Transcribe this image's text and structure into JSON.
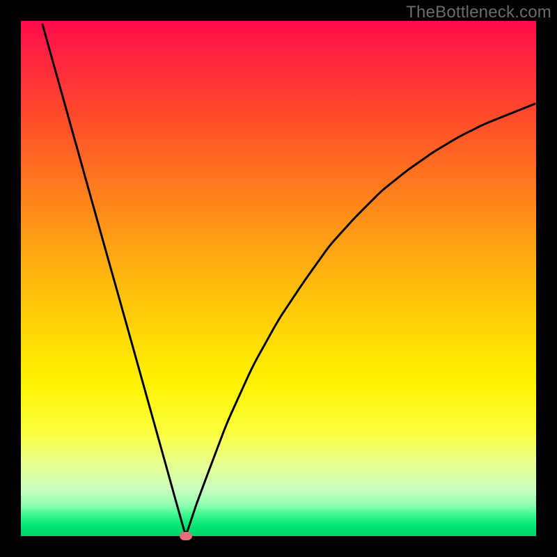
{
  "watermark": "TheBottleneck.com",
  "chart_data": {
    "type": "line",
    "title": "",
    "xlabel": "",
    "ylabel": "",
    "xlim": [
      0,
      100
    ],
    "ylim": [
      0,
      100
    ],
    "grid": false,
    "legend": false,
    "background_gradient": {
      "top_color": "#ff0b4b",
      "bottom_color": "#00d169",
      "meaning": "top=high bottleneck, bottom=low bottleneck"
    },
    "optimum_x": 32,
    "x": [
      4,
      8,
      12,
      16,
      20,
      24,
      28,
      30,
      32,
      34,
      36,
      40,
      45,
      50,
      55,
      60,
      65,
      70,
      75,
      80,
      85,
      90,
      95,
      100
    ],
    "values": [
      100,
      85.7,
      71.4,
      57.1,
      42.9,
      28.6,
      14.3,
      7.1,
      0,
      6.0,
      11.4,
      22.0,
      33.0,
      42.0,
      49.5,
      56.5,
      62.0,
      67.0,
      71.0,
      74.5,
      77.5,
      80.0,
      82.0,
      84.0
    ],
    "marker": {
      "x": 32,
      "y": 0,
      "color": "#e86f7a"
    },
    "curve_color": "#000000",
    "curve_width": 3
  }
}
